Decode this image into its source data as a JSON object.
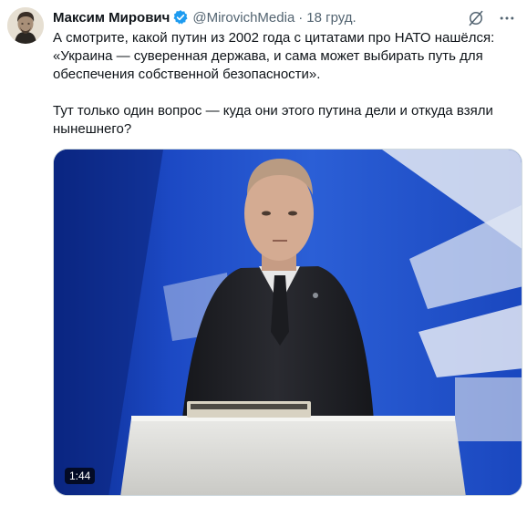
{
  "author": {
    "name": "Максим Мирович",
    "handle": "@MirovichMedia",
    "separator": "·",
    "date": "18 груд."
  },
  "icons": {
    "verified": "verified-badge-icon",
    "grok": "grok-icon",
    "more": "more-options-icon"
  },
  "colors": {
    "verified_badge": "#1d9bf0",
    "secondary_text": "#536471"
  },
  "tweet": {
    "paragraph_1": "А смотрите, какой путин из 2002 года с цитатами про НАТО нашёлся: «Украина — суверенная держава, и сама может выбирать путь для обеспечения собственной безопасности».",
    "paragraph_2": "Тут только один вопрос — куда они этого путина дели и откуда взяли нынешнего?"
  },
  "media": {
    "type": "video",
    "duration": "1:44"
  }
}
